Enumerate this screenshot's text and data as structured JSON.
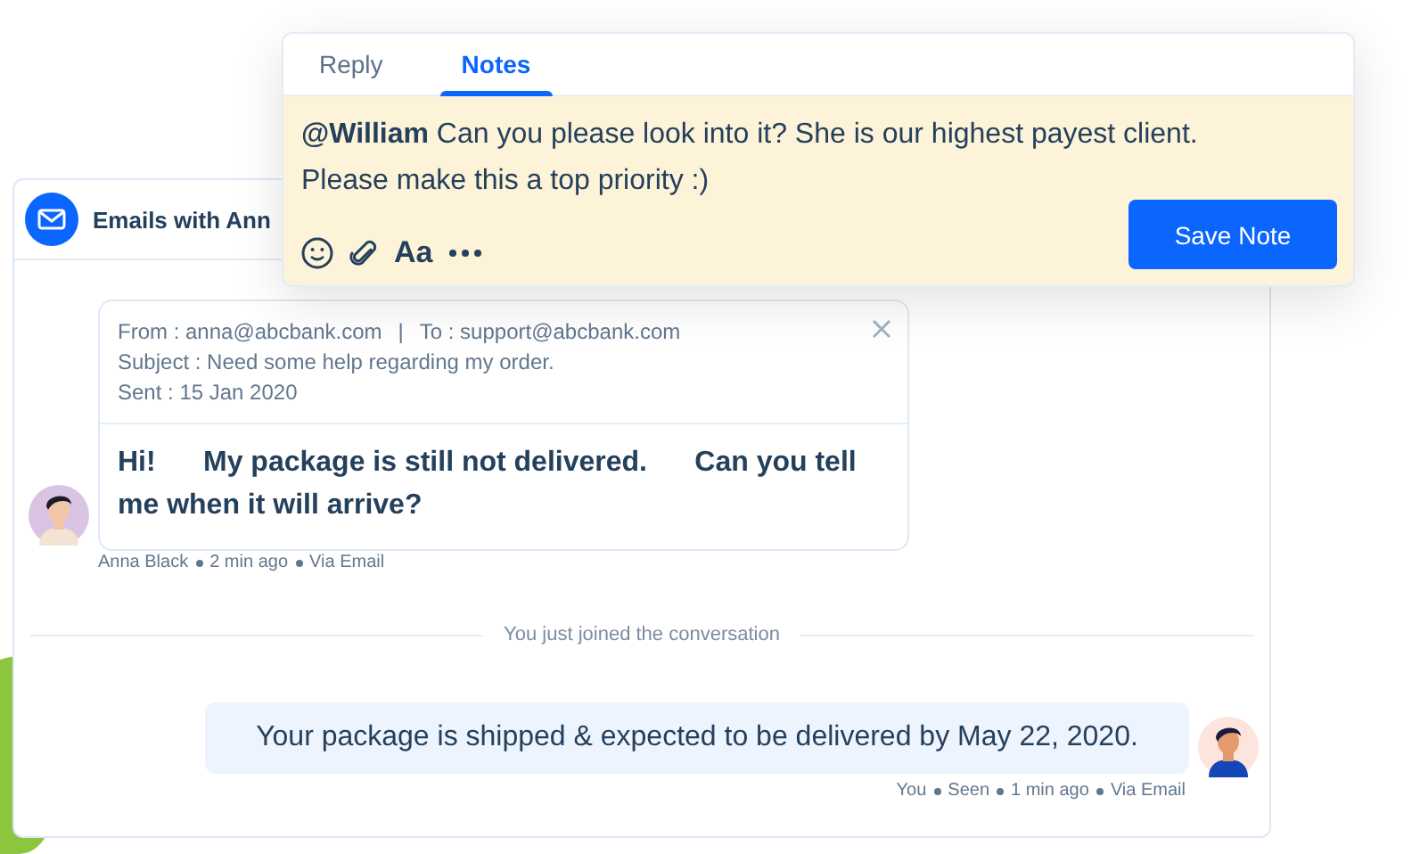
{
  "email_panel": {
    "title": "Emails with Ann"
  },
  "email": {
    "from": "From : anna@abcbank.com",
    "separator": "|",
    "to": "To : support@abcbank.com",
    "subject": "Subject : Need some help regarding my order.",
    "sent": "Sent : 15 Jan 2020",
    "body": "Hi!      My package is still not delivered.      Can you tell me when it will arrive?",
    "meta": [
      "Anna Black",
      "2 min ago",
      "Via Email"
    ]
  },
  "system_message": "You just joined the conversation",
  "reply": {
    "body": "Your package is shipped & expected to be delivered by May 22, 2020.",
    "meta": [
      "You",
      "Seen",
      "1 min ago",
      "Via Email"
    ]
  },
  "notes_popup": {
    "tabs": [
      {
        "label": "Reply",
        "selected": false
      },
      {
        "label": "Notes",
        "selected": true
      }
    ],
    "note_lines": [
      "**@William** Can you please look into it? She is our highest payest client.",
      "Please make this a top priority :)"
    ],
    "toolbar": {
      "format_label": "Aa"
    },
    "button": "Save Note"
  }
}
